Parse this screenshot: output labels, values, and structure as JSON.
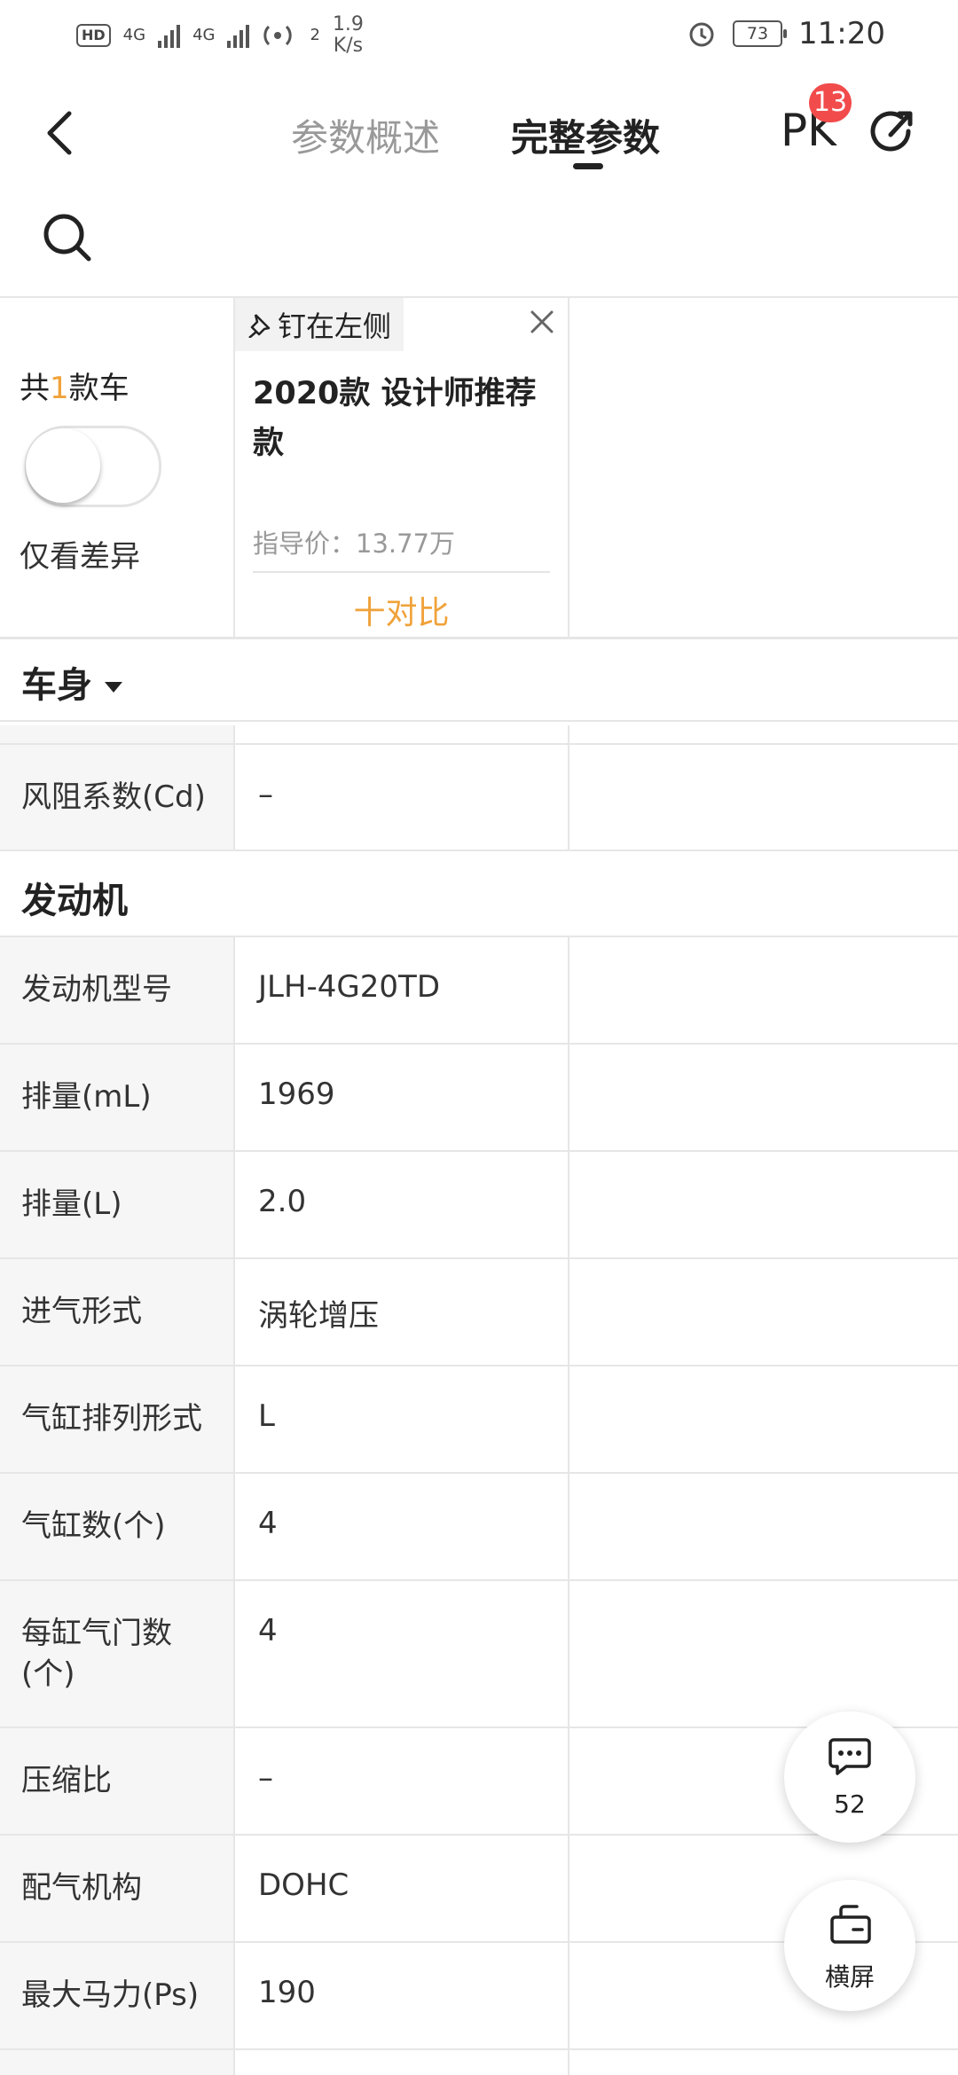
{
  "status_bar": {
    "hd": "HD",
    "net1": "4G",
    "net2": "4G",
    "wifi_num": "2",
    "speed_value": "1.9",
    "speed_unit": "K/s",
    "battery": "73",
    "time": "11:20"
  },
  "header": {
    "tab_overview": "参数概述",
    "tab_full": "完整参数",
    "pk_label": "PK",
    "pk_badge": "13"
  },
  "compare": {
    "count_prefix": "共",
    "count_num": "1",
    "count_suffix": "款车",
    "diff_label": "仅看差异",
    "pin_label": "钉在左侧",
    "car_name": "2020款 设计师推荐款",
    "price": "指导价：13.77万",
    "add_compare": "十对比"
  },
  "sections": {
    "body": "车身",
    "engine": "发动机"
  },
  "body_rows": [
    {
      "key": "风阻系数(Cd)",
      "value": "–"
    }
  ],
  "engine_rows": [
    {
      "key": "发动机型号",
      "value": "JLH-4G20TD"
    },
    {
      "key": "排量(mL)",
      "value": "1969"
    },
    {
      "key": "排量(L)",
      "value": "2.0"
    },
    {
      "key": "进气形式",
      "value": "涡轮增压"
    },
    {
      "key": "气缸排列形式",
      "value": "L"
    },
    {
      "key": "气缸数(个)",
      "value": "4"
    },
    {
      "key": "每缸气门数(个)",
      "value": "4"
    },
    {
      "key": "压缩比",
      "value": "–"
    },
    {
      "key": "配气机构",
      "value": "DOHC"
    },
    {
      "key": "最大马力(Ps)",
      "value": "190"
    }
  ],
  "fab": {
    "comments_count": "52",
    "landscape_label": "横屏"
  },
  "icons": [
    "back-icon",
    "search-icon",
    "share-icon",
    "pin-icon",
    "close-icon",
    "chat-icon",
    "landscape-icon",
    "alarm-icon",
    "wifi-icon"
  ]
}
